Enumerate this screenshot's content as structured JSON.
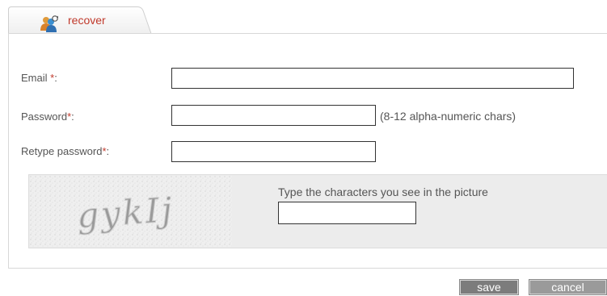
{
  "tab": {
    "label": "recover",
    "icon": "people-refresh-icon"
  },
  "form": {
    "email": {
      "label": "Email ",
      "required_mark": "*",
      "suffix": ":",
      "value": ""
    },
    "password": {
      "label": "Password",
      "required_mark": "*",
      "suffix": ":",
      "value": "",
      "hint": "(8-12 alpha-numeric chars)"
    },
    "retype_password": {
      "label": "Retype password",
      "required_mark": "*",
      "suffix": ":",
      "value": ""
    },
    "captcha": {
      "image_text": "gykIj",
      "prompt": "Type the characters you see in the picture",
      "value": ""
    }
  },
  "actions": {
    "save_label": "save",
    "cancel_label": "cancel"
  },
  "colors": {
    "accent": "#c0392b",
    "button_save": "#7c7c7c",
    "button_cancel": "#9a9a9a",
    "captcha_bg": "#ececec"
  }
}
